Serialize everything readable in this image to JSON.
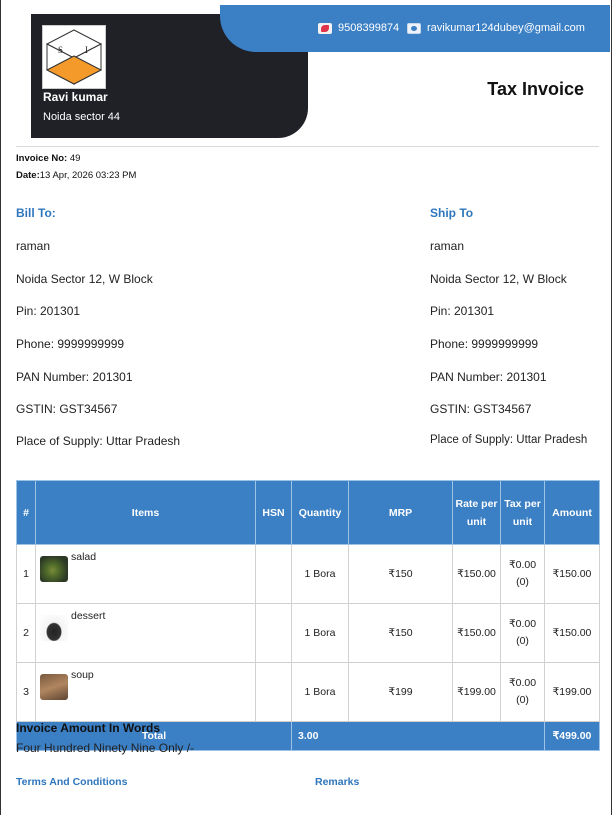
{
  "seller": {
    "name": "Ravi kumar",
    "address": "Noida sector 44",
    "logo_letters": [
      "S",
      "I"
    ],
    "phone": "9508399874",
    "email": "ravikumar124dubey@gmail.com"
  },
  "document": {
    "title": "Tax Invoice"
  },
  "invoice": {
    "number_label": "Invoice No:",
    "number": "49",
    "date_label": "Date:",
    "date": "13 Apr, 2026 03:23 PM"
  },
  "bill_to": {
    "heading": "Bill To:",
    "lines": [
      "raman",
      "Noida Sector 12, W Block",
      "Pin: 201301",
      "Phone: 9999999999",
      "PAN Number: 201301",
      "GSTIN: GST34567",
      "Place of Supply: Uttar Pradesh"
    ]
  },
  "ship_to": {
    "heading": "Ship To",
    "lines": [
      "raman",
      "Noida Sector 12, W Block",
      "Pin: 201301",
      "Phone: 9999999999",
      "PAN Number: 201301",
      "GSTIN: GST34567",
      "Place of Supply: Uttar Pradesh"
    ]
  },
  "table": {
    "headers": [
      "#",
      "Items",
      "HSN",
      "Quantity",
      "MRP",
      "Rate per unit",
      "Tax per unit",
      "Amount"
    ],
    "rows": [
      {
        "index": "1",
        "item": "salad",
        "image": "salad-thumbnail",
        "hsn": "",
        "quantity": "1 Bora",
        "mrp": "₹150",
        "rate": "₹150.00",
        "tax": "₹0.00 (0)",
        "amount": "₹150.00"
      },
      {
        "index": "2",
        "item": "dessert",
        "image": "dessert-thumbnail",
        "hsn": "",
        "quantity": "1 Bora",
        "mrp": "₹150",
        "rate": "₹150.00",
        "tax": "₹0.00 (0)",
        "amount": "₹150.00"
      },
      {
        "index": "3",
        "item": "soup",
        "image": "soup-thumbnail",
        "hsn": "",
        "quantity": "1 Bora",
        "mrp": "₹199",
        "rate": "₹199.00",
        "tax": "₹0.00 (0)",
        "amount": "₹199.00"
      }
    ],
    "total": {
      "label": "Total",
      "quantity": "3.00",
      "amount": "₹499.00"
    }
  },
  "amount_in_words": {
    "heading": "Invoice Amount In Words",
    "text": "Four Hundred Ninety Nine Only /-"
  },
  "footer": {
    "terms_heading": "Terms And Conditions",
    "remarks_heading": "Remarks"
  },
  "icons": {
    "phone": "phone-icon",
    "email": "email-icon"
  },
  "colors": {
    "accent": "#3b7fc4",
    "dark": "#1f2127",
    "heading_blue": "#2e76bd"
  }
}
